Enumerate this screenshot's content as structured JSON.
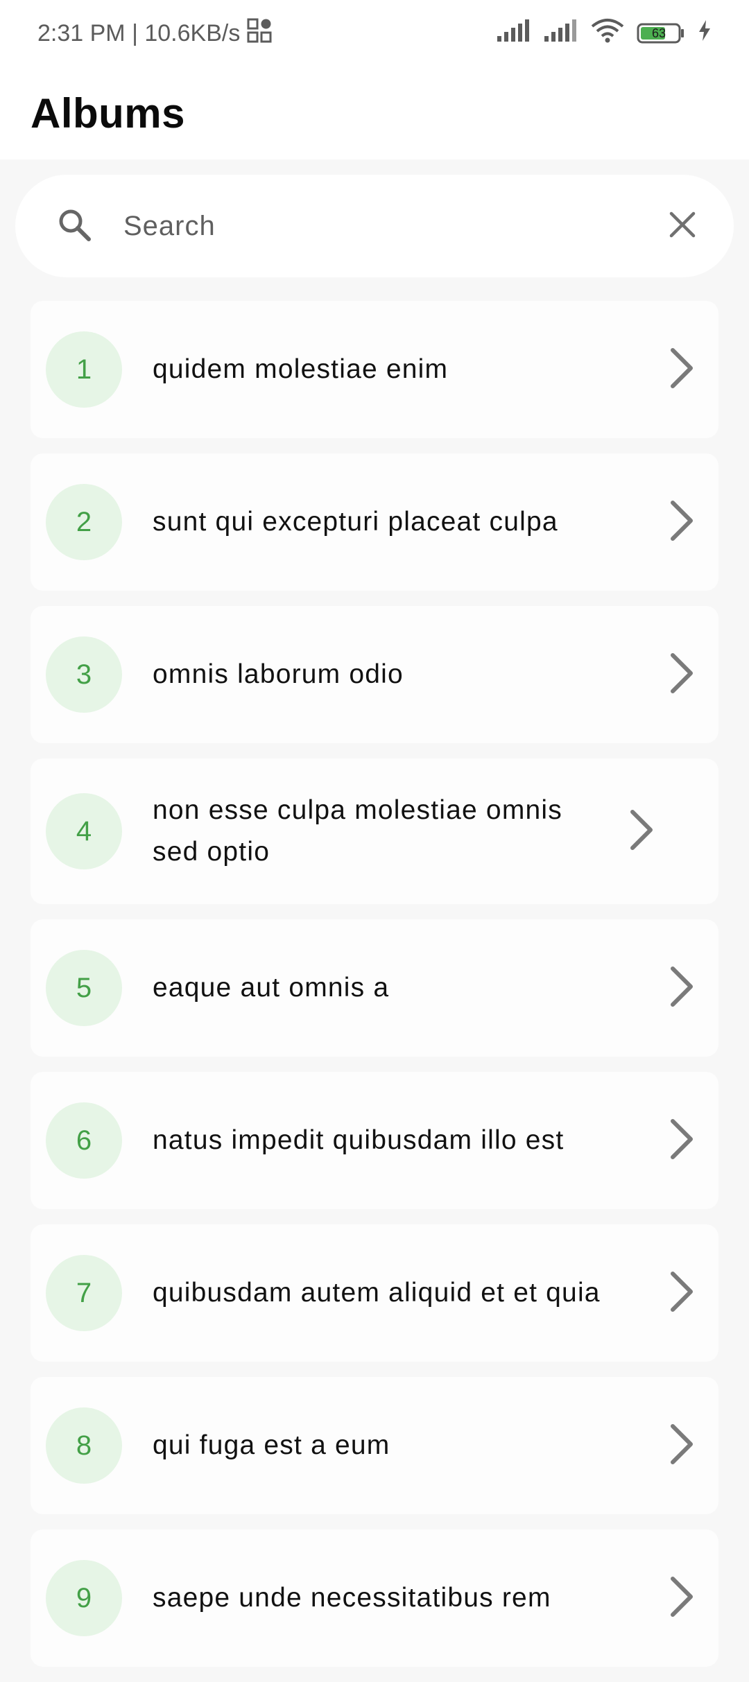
{
  "status_bar": {
    "time_and_speed": "2:31 PM | 10.6KB/s",
    "battery_level": "63",
    "icons": [
      "qr-grid-icon",
      "cellular-signal-icon",
      "cellular-signal-icon",
      "wifi-icon",
      "battery-icon",
      "charging-bolt-icon"
    ]
  },
  "header": {
    "title": "Albums"
  },
  "search": {
    "placeholder": "Search",
    "value": "",
    "icon": "search-icon",
    "clear_icon": "close-icon"
  },
  "albums": [
    {
      "id": "1",
      "title": "quidem molestiae enim"
    },
    {
      "id": "2",
      "title": "sunt qui excepturi placeat culpa"
    },
    {
      "id": "3",
      "title": "omnis laborum odio"
    },
    {
      "id": "4",
      "title": "non esse culpa molestiae omnis sed optio"
    },
    {
      "id": "5",
      "title": "eaque aut omnis a"
    },
    {
      "id": "6",
      "title": "natus impedit quibusdam illo est"
    },
    {
      "id": "7",
      "title": "quibusdam autem aliquid et et quia"
    },
    {
      "id": "8",
      "title": "qui fuga est a eum"
    },
    {
      "id": "9",
      "title": "saepe unde necessitatibus rem"
    }
  ],
  "colors": {
    "accent_green": "#43a047",
    "badge_background": "#e6f5e6",
    "page_background": "#f7f7f7",
    "chevron_gray": "#7a7a7a"
  }
}
